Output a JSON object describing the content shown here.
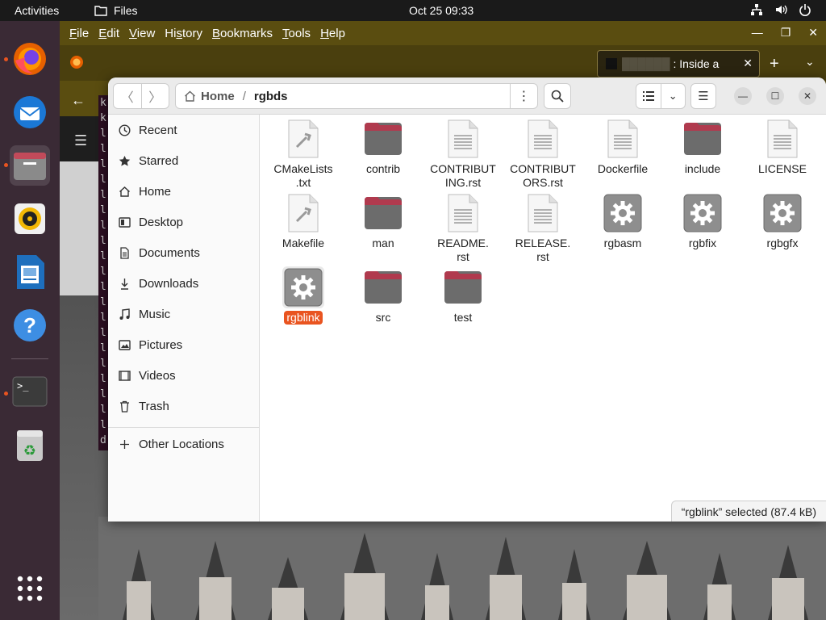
{
  "topbar": {
    "activities": "Activities",
    "app_name": "Files",
    "clock": "Oct 25  09:33"
  },
  "firefox": {
    "menus": [
      "File",
      "Edit",
      "View",
      "History",
      "Bookmarks",
      "Tools",
      "Help"
    ],
    "menu_access": [
      "F",
      "E",
      "V",
      "s",
      "B",
      "T",
      "H"
    ],
    "tab_title": ": Inside a",
    "terminal_lines": [
      "k",
      "k",
      "l",
      "l",
      "l",
      "l",
      "l",
      "l",
      "l",
      "l",
      "l",
      "l",
      "l",
      "l",
      "l",
      "l",
      "l",
      "l",
      "l",
      "l",
      "l",
      "l",
      "d"
    ]
  },
  "files": {
    "path": {
      "home": "Home",
      "separator": "/",
      "current": "rgbds"
    },
    "sidebar": [
      {
        "label": "Recent",
        "icon": "clock-icon"
      },
      {
        "label": "Starred",
        "icon": "star-icon"
      },
      {
        "label": "Home",
        "icon": "home-icon"
      },
      {
        "label": "Desktop",
        "icon": "desktop-icon"
      },
      {
        "label": "Documents",
        "icon": "document-icon"
      },
      {
        "label": "Downloads",
        "icon": "download-icon"
      },
      {
        "label": "Music",
        "icon": "music-icon"
      },
      {
        "label": "Pictures",
        "icon": "picture-icon"
      },
      {
        "label": "Videos",
        "icon": "video-icon"
      },
      {
        "label": "Trash",
        "icon": "trash-icon"
      },
      {
        "label": "Other Locations",
        "icon": "plus-icon"
      }
    ],
    "items": [
      {
        "name": "CMakeLists\n.txt",
        "type": "script"
      },
      {
        "name": "contrib",
        "type": "folder"
      },
      {
        "name": "CONTRIBUT\nING.rst",
        "type": "text"
      },
      {
        "name": "CONTRIBUT\nORS.rst",
        "type": "text"
      },
      {
        "name": "Dockerfile",
        "type": "text"
      },
      {
        "name": "include",
        "type": "folder"
      },
      {
        "name": "LICENSE",
        "type": "text"
      },
      {
        "name": "Makefile",
        "type": "script"
      },
      {
        "name": "man",
        "type": "folder"
      },
      {
        "name": "README.\nrst",
        "type": "text"
      },
      {
        "name": "RELEASE.\nrst",
        "type": "text"
      },
      {
        "name": "rgbasm",
        "type": "exec"
      },
      {
        "name": "rgbfix",
        "type": "exec"
      },
      {
        "name": "rgbgfx",
        "type": "exec"
      },
      {
        "name": "rgblink",
        "type": "exec",
        "selected": true
      },
      {
        "name": "src",
        "type": "folder"
      },
      {
        "name": "test",
        "type": "folder"
      }
    ],
    "status": "“rgblink” selected  (87.4 kB)"
  },
  "colors": {
    "accent": "#e95420",
    "folder_top": "#b03a4e",
    "folder_body": "#6c6c6c"
  }
}
